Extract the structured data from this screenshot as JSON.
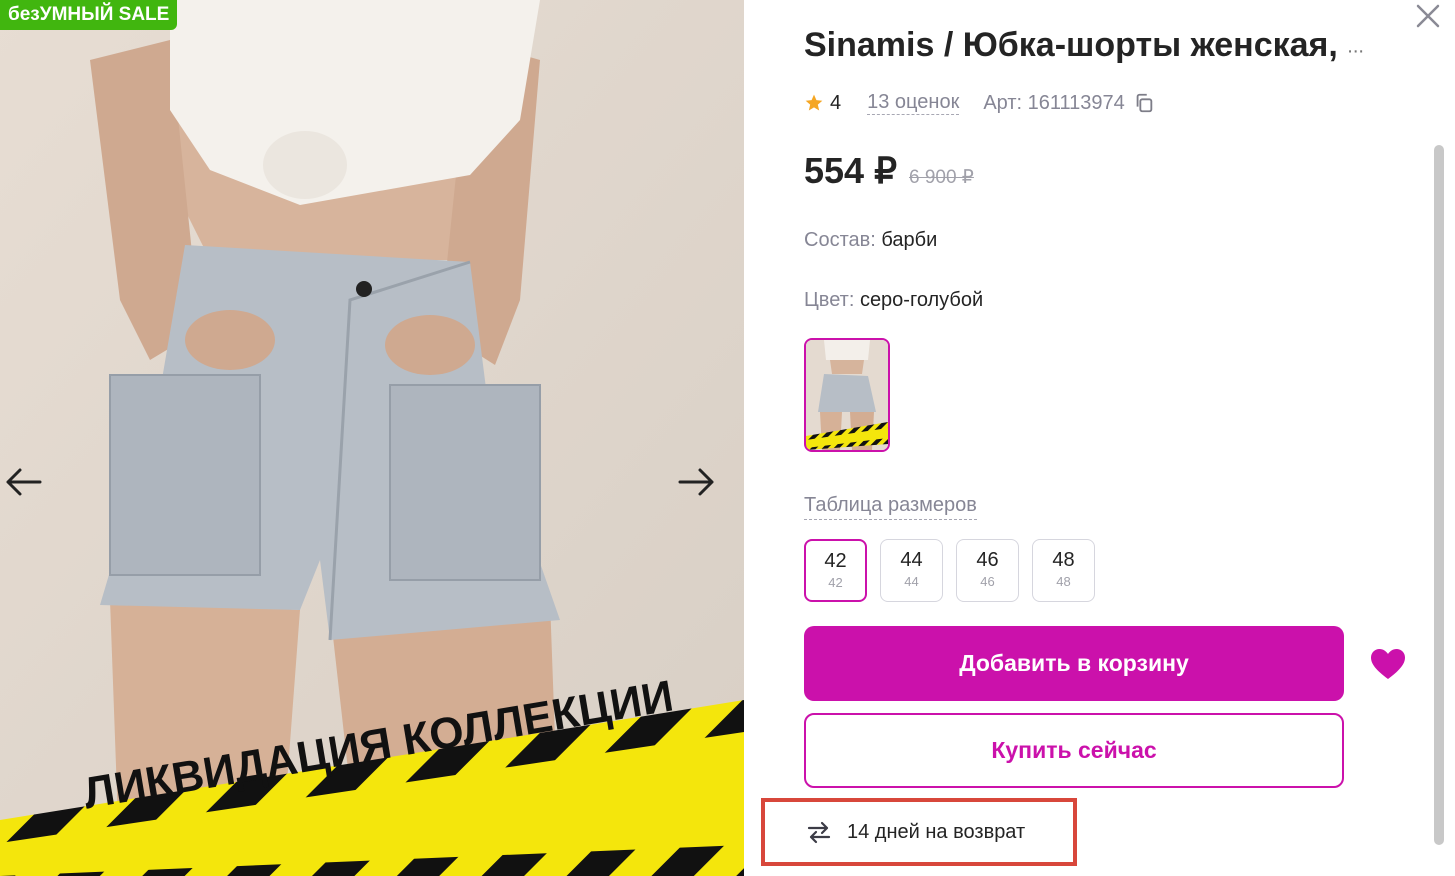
{
  "gallery": {
    "sale_badge": "безУМНЫЙ SALE",
    "banner_text": "ЛИКВИДАЦИЯ КОЛЛЕКЦИИ",
    "prev_icon": "arrow-left-icon",
    "next_icon": "arrow-right-icon"
  },
  "product": {
    "title": "Sinamis / Юбка-шорты женская,",
    "title_ellipsis": "...",
    "rating": "4",
    "reviews": "13 оценок",
    "article": "Арт: 161113974",
    "price": "554 ₽",
    "old_price": "6 900 ₽",
    "composition_label": "Состав:",
    "composition_value": "барби",
    "color_label": "Цвет:",
    "color_value": "серо-голубой",
    "size_table_link": "Таблица размеров",
    "sizes": [
      {
        "size": "42",
        "ru": "42",
        "selected": true
      },
      {
        "size": "44",
        "ru": "44",
        "selected": false
      },
      {
        "size": "46",
        "ru": "46",
        "selected": false
      },
      {
        "size": "48",
        "ru": "48",
        "selected": false
      }
    ],
    "add_to_cart": "Добавить в корзину",
    "buy_now": "Купить сейчас",
    "return_text": "14 дней на возврат"
  },
  "colors": {
    "accent": "#cb11ab",
    "sale_green": "#41b60f",
    "highlight_red": "#d8473b",
    "star": "#f5a623"
  }
}
